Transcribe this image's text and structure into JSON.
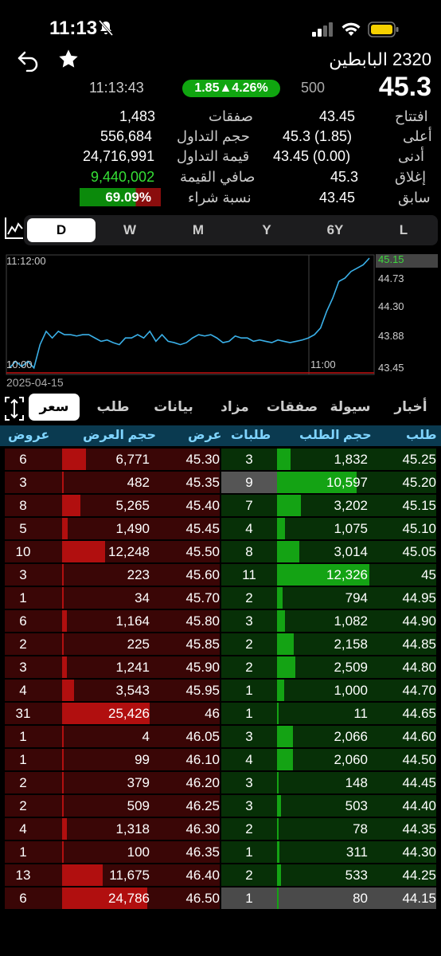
{
  "status": {
    "time": "11:13"
  },
  "header": {
    "title": "2320 البابطين",
    "time": "11:13:43",
    "change": "1.85▲4.26%",
    "volume": "500",
    "last": "45.3"
  },
  "stats_left": [
    {
      "label": "صفقات",
      "value": "1,483"
    },
    {
      "label": "حجم التداول",
      "value": "556,684"
    },
    {
      "label": "قيمة التداول",
      "value": "24,716,991"
    },
    {
      "label": "صافي القيمة",
      "value": "9,440,002"
    },
    {
      "label": "نسبة شراء",
      "value": "69.09%"
    }
  ],
  "stats_right": [
    {
      "label": "افتتاح",
      "value": "43.45"
    },
    {
      "label": "أعلى",
      "value": "45.3 (1.85)"
    },
    {
      "label": "أدنى",
      "value": "43.45 (0.00)"
    },
    {
      "label": "إغلاق",
      "value": "45.3"
    },
    {
      "label": "سابق",
      "value": "43.45"
    }
  ],
  "buy_ratio": 0.6909,
  "periods": [
    "D",
    "W",
    "M",
    "Y",
    "6Y",
    "L"
  ],
  "chart_data": {
    "type": "line",
    "date": "2025-04-15",
    "x_labels": [
      "10:00",
      "11:00"
    ],
    "top_time": "11:12:00",
    "y_ticks": [
      "45.15",
      "44.73",
      "44.30",
      "43.88",
      "43.45"
    ],
    "ylim": [
      43.45,
      45.15
    ],
    "values": [
      43.5,
      43.6,
      43.52,
      43.6,
      43.5,
      43.85,
      44.05,
      43.95,
      44.05,
      44.0,
      44.0,
      43.98,
      44.0,
      44.0,
      43.95,
      43.9,
      43.92,
      43.88,
      43.85,
      43.95,
      43.95,
      44.0,
      43.95,
      44.05,
      43.9,
      44.0,
      43.9,
      43.88,
      43.85,
      43.88,
      43.95,
      44.0,
      43.98,
      44.0,
      43.95,
      43.88,
      43.9,
      43.98,
      43.95,
      43.95,
      43.9,
      43.92,
      43.9,
      43.88,
      43.92,
      43.9,
      43.88,
      43.9,
      43.92,
      43.95,
      44.0,
      44.1,
      44.35,
      44.55,
      44.8,
      44.85,
      44.95,
      45.0,
      45.05,
      45.15
    ]
  },
  "tabs": [
    "سعر",
    "طلب",
    "بيانات",
    "مزاد",
    "صفقات",
    "سيولة",
    "أخبار"
  ],
  "book_headers": {
    "bid": "طلب",
    "bid_size": "حجم الطلب",
    "bid_orders": "طلبات",
    "ask": "عرض",
    "ask_size": "حجم العرض",
    "ask_orders": "عروض"
  },
  "book": [
    {
      "ask_orders": "6",
      "ask_size": "6,771",
      "ask_frac": 0.27,
      "ask": "45.30",
      "bid_orders": "3",
      "bid_size": "1,832",
      "bid_frac": 0.15,
      "bid": "45.25"
    },
    {
      "ask_orders": "3",
      "ask_size": "482",
      "ask_frac": 0.02,
      "ask": "45.35",
      "bid_orders": "9",
      "bid_size": "10,597",
      "bid_frac": 0.86,
      "bid": "45.20"
    },
    {
      "ask_orders": "8",
      "ask_size": "5,265",
      "ask_frac": 0.21,
      "ask": "45.40",
      "bid_orders": "7",
      "bid_size": "3,202",
      "bid_frac": 0.26,
      "bid": "45.15"
    },
    {
      "ask_orders": "5",
      "ask_size": "1,490",
      "ask_frac": 0.06,
      "ask": "45.45",
      "bid_orders": "4",
      "bid_size": "1,075",
      "bid_frac": 0.09,
      "bid": "45.10"
    },
    {
      "ask_orders": "10",
      "ask_size": "12,248",
      "ask_frac": 0.49,
      "ask": "45.50",
      "bid_orders": "8",
      "bid_size": "3,014",
      "bid_frac": 0.24,
      "bid": "45.05"
    },
    {
      "ask_orders": "3",
      "ask_size": "223",
      "ask_frac": 0.01,
      "ask": "45.60",
      "bid_orders": "11",
      "bid_size": "12,326",
      "bid_frac": 1.0,
      "bid": "45"
    },
    {
      "ask_orders": "1",
      "ask_size": "34",
      "ask_frac": 0.0,
      "ask": "45.70",
      "bid_orders": "2",
      "bid_size": "794",
      "bid_frac": 0.06,
      "bid": "44.95"
    },
    {
      "ask_orders": "6",
      "ask_size": "1,164",
      "ask_frac": 0.05,
      "ask": "45.80",
      "bid_orders": "3",
      "bid_size": "1,082",
      "bid_frac": 0.09,
      "bid": "44.90"
    },
    {
      "ask_orders": "2",
      "ask_size": "225",
      "ask_frac": 0.01,
      "ask": "45.85",
      "bid_orders": "2",
      "bid_size": "2,158",
      "bid_frac": 0.18,
      "bid": "44.85"
    },
    {
      "ask_orders": "3",
      "ask_size": "1,241",
      "ask_frac": 0.05,
      "ask": "45.90",
      "bid_orders": "2",
      "bid_size": "2,509",
      "bid_frac": 0.2,
      "bid": "44.80"
    },
    {
      "ask_orders": "4",
      "ask_size": "3,543",
      "ask_frac": 0.14,
      "ask": "45.95",
      "bid_orders": "1",
      "bid_size": "1,000",
      "bid_frac": 0.08,
      "bid": "44.70"
    },
    {
      "ask_orders": "31",
      "ask_size": "25,426",
      "ask_frac": 1.0,
      "ask": "46",
      "bid_orders": "1",
      "bid_size": "11",
      "bid_frac": 0.0,
      "bid": "44.65"
    },
    {
      "ask_orders": "1",
      "ask_size": "4",
      "ask_frac": 0.0,
      "ask": "46.05",
      "bid_orders": "3",
      "bid_size": "2,066",
      "bid_frac": 0.17,
      "bid": "44.60"
    },
    {
      "ask_orders": "1",
      "ask_size": "99",
      "ask_frac": 0.0,
      "ask": "46.10",
      "bid_orders": "4",
      "bid_size": "2,060",
      "bid_frac": 0.17,
      "bid": "44.50"
    },
    {
      "ask_orders": "2",
      "ask_size": "379",
      "ask_frac": 0.02,
      "ask": "46.20",
      "bid_orders": "3",
      "bid_size": "148",
      "bid_frac": 0.01,
      "bid": "44.45"
    },
    {
      "ask_orders": "2",
      "ask_size": "509",
      "ask_frac": 0.02,
      "ask": "46.25",
      "bid_orders": "3",
      "bid_size": "503",
      "bid_frac": 0.04,
      "bid": "44.40"
    },
    {
      "ask_orders": "4",
      "ask_size": "1,318",
      "ask_frac": 0.05,
      "ask": "46.30",
      "bid_orders": "2",
      "bid_size": "78",
      "bid_frac": 0.01,
      "bid": "44.35"
    },
    {
      "ask_orders": "1",
      "ask_size": "100",
      "ask_frac": 0.0,
      "ask": "46.35",
      "bid_orders": "1",
      "bid_size": "311",
      "bid_frac": 0.03,
      "bid": "44.30"
    },
    {
      "ask_orders": "13",
      "ask_size": "11,675",
      "ask_frac": 0.46,
      "ask": "46.40",
      "bid_orders": "2",
      "bid_size": "533",
      "bid_frac": 0.04,
      "bid": "44.25"
    },
    {
      "ask_orders": "6",
      "ask_size": "24,786",
      "ask_frac": 0.97,
      "ask": "46.50",
      "bid_orders": "1",
      "bid_size": "80",
      "bid_frac": 0.01,
      "bid": "44.15"
    }
  ]
}
